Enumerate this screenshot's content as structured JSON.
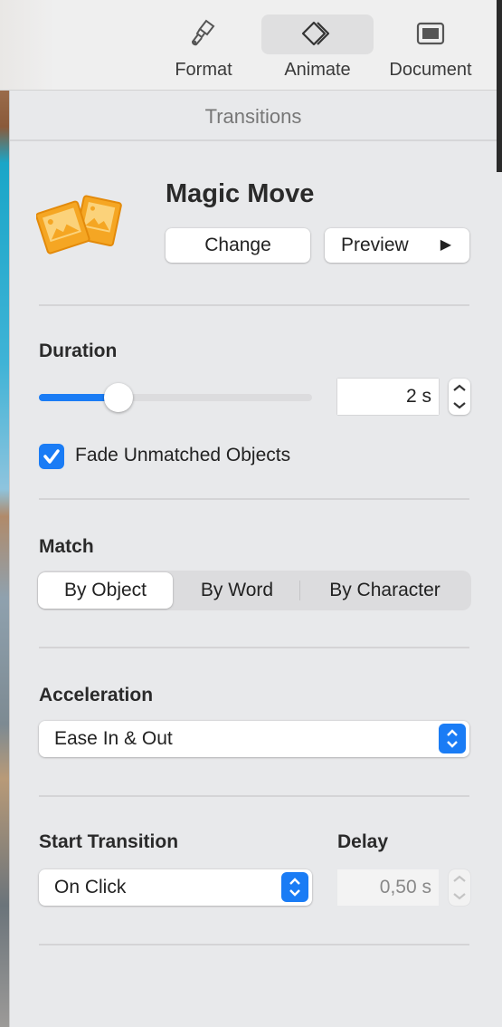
{
  "toolbar": {
    "tabs": [
      {
        "label": "Format",
        "icon": "paintbrush-icon"
      },
      {
        "label": "Animate",
        "icon": "animate-diamonds-icon",
        "selected": true
      },
      {
        "label": "Document",
        "icon": "document-icon"
      }
    ]
  },
  "section_title": "Transitions",
  "transition": {
    "name": "Magic Move",
    "icon": "magic-move-icon",
    "change_label": "Change",
    "preview_label": "Preview",
    "preview_icon": "play-icon"
  },
  "duration": {
    "label": "Duration",
    "slider_percent": 29,
    "value": "2 s"
  },
  "fade": {
    "label": "Fade Unmatched Objects",
    "checked": true
  },
  "match": {
    "label": "Match",
    "options": [
      "By Object",
      "By Word",
      "By Character"
    ],
    "selected": "By Object"
  },
  "acceleration": {
    "label": "Acceleration",
    "value": "Ease In & Out"
  },
  "start": {
    "label": "Start Transition",
    "value": "On Click"
  },
  "delay": {
    "label": "Delay",
    "value": "0,50 s",
    "disabled": true
  },
  "colors": {
    "accent": "#1a7cf5",
    "icon_orange": "#f5a623",
    "panel_bg": "#e8e9eb"
  }
}
